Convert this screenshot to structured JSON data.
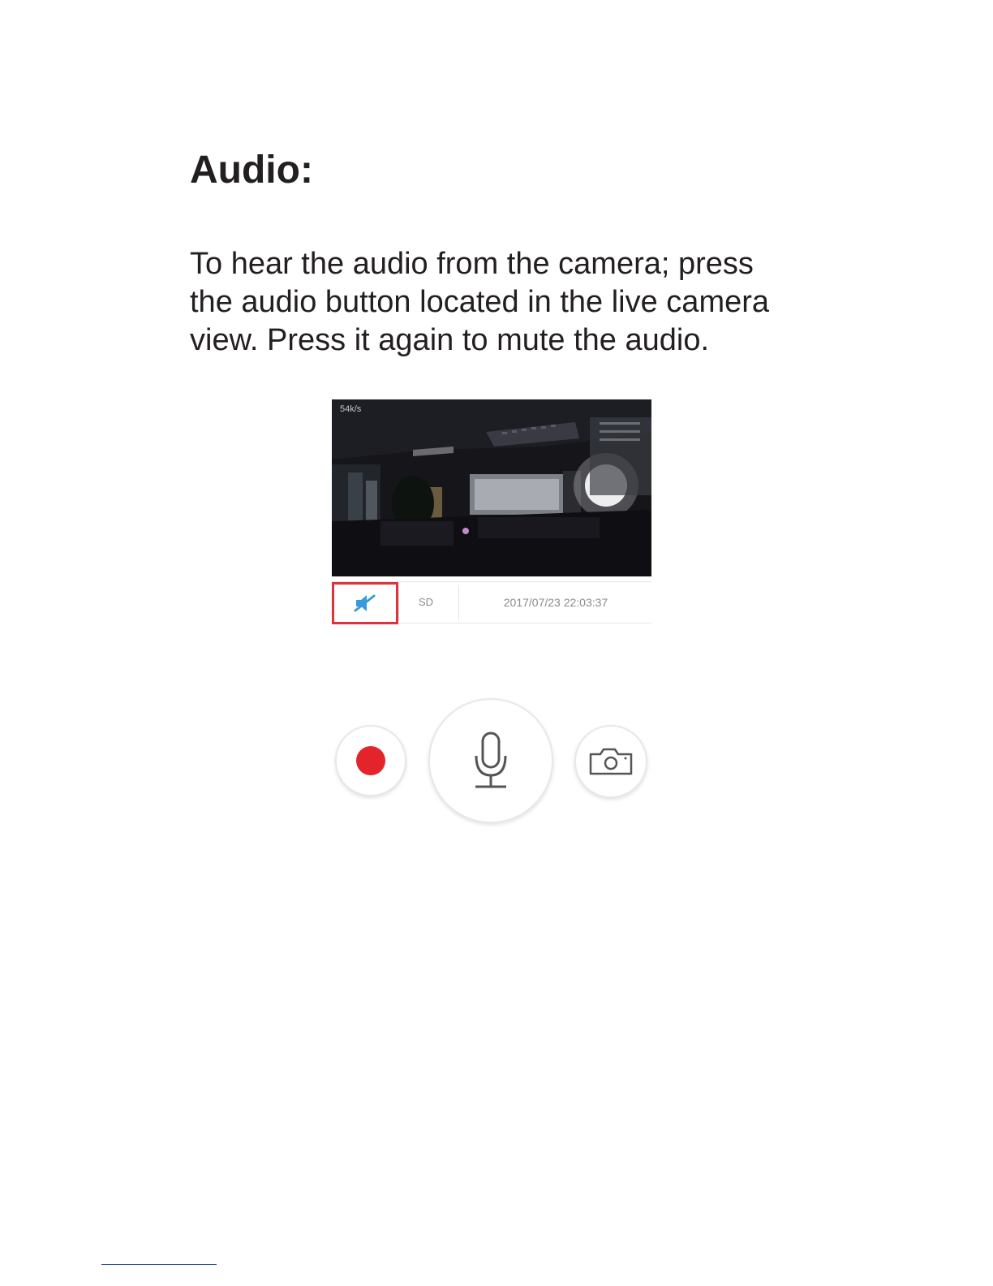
{
  "heading": "Audio:",
  "paragraph": "To hear the audio from the camera; press the audio button located in the live camera view. Press it again to mute the audio.",
  "live_view": {
    "bitrate": "54k/s"
  },
  "status_bar": {
    "audio_icon": "speaker-muted-icon",
    "quality": "SD",
    "timestamp": "2017/07/23 22:03:37"
  },
  "controls": {
    "record_icon": "record-icon",
    "talk_icon": "microphone-icon",
    "snapshot_icon": "camera-icon"
  },
  "colors": {
    "highlight": "#e0323a",
    "record": "#e3242b",
    "audio_icon": "#3a9ad9"
  }
}
